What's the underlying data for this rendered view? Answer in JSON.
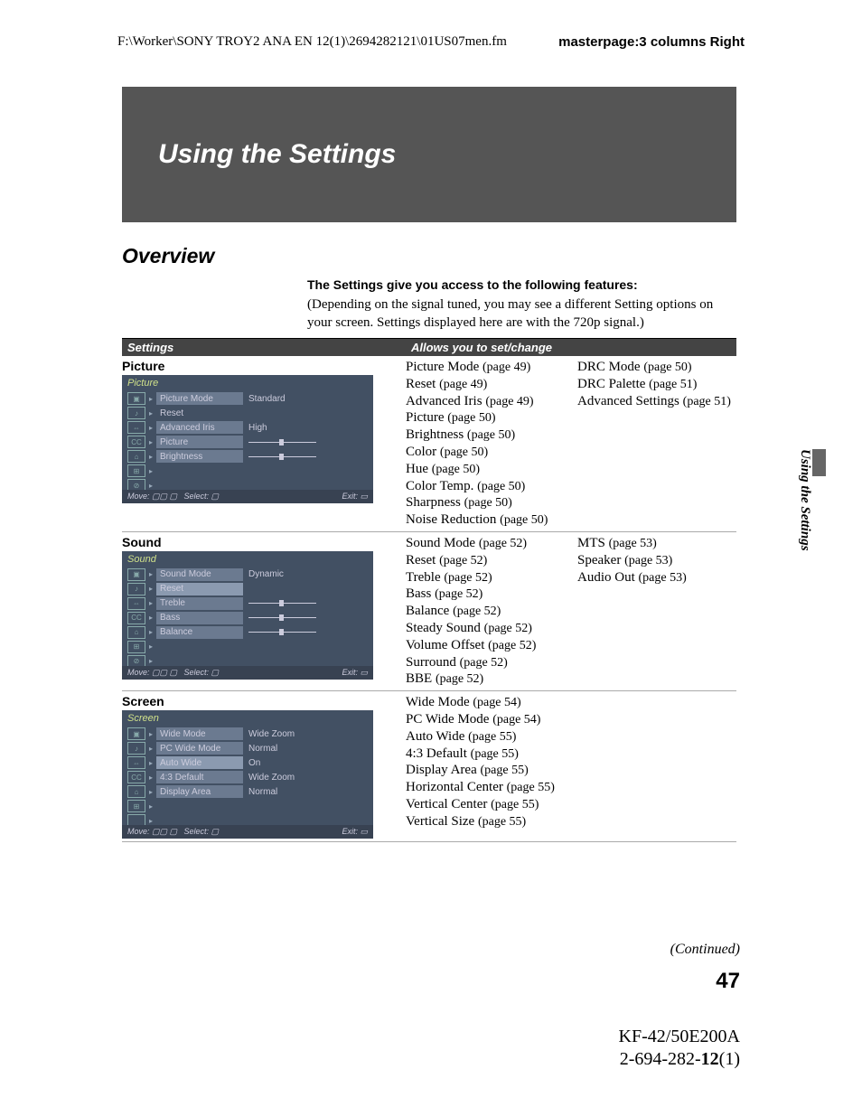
{
  "header": {
    "path": "F:\\Worker\\SONY TROY2 ANA EN 12(1)\\2694282121\\01US07men.fm",
    "master": "masterpage:3 columns Right"
  },
  "sideTab": "Using the Settings",
  "bannerTitle": "Using the Settings",
  "overviewHeading": "Overview",
  "intro": {
    "bold": "The Settings give you access to the following features:",
    "body": "(Depending on the signal tuned, you may see a different Setting options on your screen. Settings displayed here are with the 720p signal.)"
  },
  "tableHeaders": {
    "c1": "Settings",
    "c2": "Allows you to set/change"
  },
  "rows": [
    {
      "name": "Picture",
      "osd": {
        "title": "Picture",
        "items": [
          {
            "icon": "▣",
            "label": "Picture Mode",
            "value": "Standard",
            "hl": true
          },
          {
            "icon": "♪",
            "label": "Reset",
            "value": ""
          },
          {
            "icon": "⇔",
            "label": "Advanced Iris",
            "value": "High",
            "hl": true
          },
          {
            "icon": "CC",
            "label": "Picture",
            "slider": true,
            "hl": true
          },
          {
            "icon": "⌂",
            "label": "Brightness",
            "slider": true,
            "hl": true
          },
          {
            "icon": "⊞",
            "label": "",
            "value": ""
          },
          {
            "icon": "⊘",
            "label": "",
            "value": ""
          }
        ],
        "footer": {
          "move": "Move:",
          "select": "Select:",
          "exit": "Exit:"
        }
      },
      "col2": [
        {
          "t": "Picture Mode",
          "p": "(page 49)"
        },
        {
          "t": "Reset",
          "p": "(page 49)"
        },
        {
          "t": "Advanced Iris",
          "p": "(page 49)"
        },
        {
          "t": "Picture",
          "p": "(page 50)"
        },
        {
          "t": "Brightness",
          "p": "(page 50)"
        },
        {
          "t": "Color",
          "p": "(page 50)"
        },
        {
          "t": "Hue",
          "p": "(page 50)"
        },
        {
          "t": "Color Temp.",
          "p": "(page 50)"
        },
        {
          "t": "Sharpness",
          "p": "(page 50)"
        },
        {
          "t": "Noise Reduction",
          "p": "(page 50)"
        }
      ],
      "col3": [
        {
          "t": "DRC Mode",
          "p": "(page 50)"
        },
        {
          "t": "DRC Palette",
          "p": "(page 51)"
        },
        {
          "t": "Advanced Settings",
          "p": "(page 51)"
        }
      ]
    },
    {
      "name": "Sound",
      "osd": {
        "title": "Sound",
        "items": [
          {
            "icon": "▣",
            "label": "Sound Mode",
            "value": "Dynamic",
            "hl": true
          },
          {
            "icon": "♪",
            "label": "Reset",
            "value": "",
            "sel": true
          },
          {
            "icon": "⇔",
            "label": "Treble",
            "slider": true,
            "hl": true
          },
          {
            "icon": "CC",
            "label": "Bass",
            "slider": true,
            "hl": true
          },
          {
            "icon": "⌂",
            "label": "Balance",
            "slider": true,
            "hl": true
          },
          {
            "icon": "⊞",
            "label": "",
            "value": ""
          },
          {
            "icon": "⊘",
            "label": "",
            "value": ""
          }
        ],
        "footer": {
          "move": "Move:",
          "select": "Select:",
          "exit": "Exit:"
        }
      },
      "col2": [
        {
          "t": "Sound Mode",
          "p": "(page 52)"
        },
        {
          "t": "Reset",
          "p": "(page 52)"
        },
        {
          "t": "Treble",
          "p": "(page 52)"
        },
        {
          "t": "Bass",
          "p": "(page 52)"
        },
        {
          "t": "Balance",
          "p": "(page 52)"
        },
        {
          "t": "Steady Sound",
          "p": "(page 52)"
        },
        {
          "t": "Volume Offset",
          "p": "(page 52)"
        },
        {
          "t": "Surround",
          "p": "(page 52)"
        },
        {
          "t": "BBE",
          "p": "(page 52)"
        }
      ],
      "col3": [
        {
          "t": "MTS",
          "p": "(page 53)"
        },
        {
          "t": "Speaker",
          "p": "(page 53)"
        },
        {
          "t": "Audio Out",
          "p": "(page 53)"
        }
      ]
    },
    {
      "name": "Screen",
      "osd": {
        "title": "Screen",
        "items": [
          {
            "icon": "▣",
            "label": "Wide Mode",
            "value": "Wide Zoom",
            "hl": true
          },
          {
            "icon": "♪",
            "label": "PC Wide Mode",
            "value": "Normal",
            "hl": true
          },
          {
            "icon": "⇔",
            "label": "Auto Wide",
            "value": "On",
            "hl": true,
            "sel": true
          },
          {
            "icon": "CC",
            "label": "4:3 Default",
            "value": "Wide Zoom",
            "hl": true
          },
          {
            "icon": "⌂",
            "label": "Display Area",
            "value": "Normal",
            "hl": true
          },
          {
            "icon": "⊞",
            "label": "",
            "value": ""
          },
          {
            "icon": "",
            "label": "",
            "value": ""
          }
        ],
        "footer": {
          "move": "Move:",
          "select": "Select:",
          "exit": "Exit:"
        }
      },
      "col2": [
        {
          "t": "Wide Mode",
          "p": "(page 54)"
        },
        {
          "t": "PC Wide Mode",
          "p": "(page 54)"
        },
        {
          "t": "Auto Wide",
          "p": "(page 55)"
        },
        {
          "t": "4:3 Default",
          "p": "(page 55)"
        },
        {
          "t": "Display Area",
          "p": "(page 55)"
        },
        {
          "t": "Horizontal Center",
          "p": "(page 55)"
        },
        {
          "t": "Vertical Center",
          "p": "(page 55)"
        },
        {
          "t": "Vertical Size",
          "p": "(page 55)"
        }
      ],
      "col3": []
    }
  ],
  "continued": "(Continued)",
  "pageNumber": "47",
  "footer": {
    "model": "KF-42/50E200A",
    "docA": "2-694-282-",
    "docB": "12",
    "docC": "(1)"
  }
}
